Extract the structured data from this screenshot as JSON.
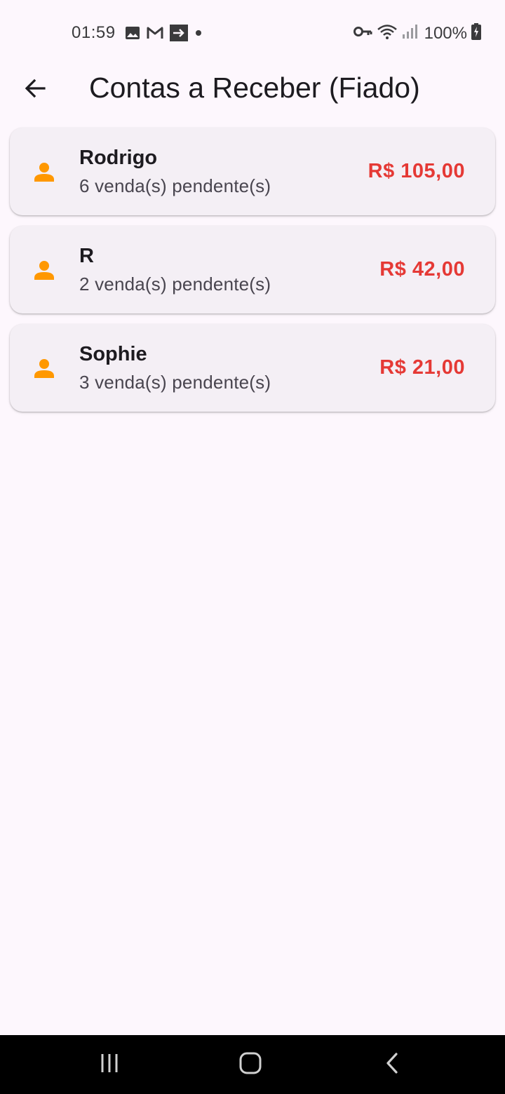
{
  "status_bar": {
    "time": "01:59",
    "battery": "100%",
    "left_icons": [
      "image-icon",
      "gmail-icon",
      "cast-icon",
      "dot-icon"
    ],
    "right_icons": [
      "vpn-key-icon",
      "wifi-icon",
      "signal-icon",
      "battery-charging-icon"
    ]
  },
  "app_bar": {
    "title": "Contas a Receber (Fiado)",
    "back_icon": "arrow-back-icon"
  },
  "colors": {
    "background": "#fdf7fd",
    "card": "#f4eff5",
    "person_icon": "#ff9800",
    "amount": "#e53935",
    "text": "#1d1b20",
    "subtext": "#49454f"
  },
  "customers": [
    {
      "name": "Rodrigo",
      "pending": "6 venda(s) pendente(s)",
      "amount": "R$ 105,00"
    },
    {
      "name": "R",
      "pending": "2 venda(s) pendente(s)",
      "amount": "R$ 42,00"
    },
    {
      "name": "Sophie",
      "pending": "3 venda(s) pendente(s)",
      "amount": "R$ 21,00"
    }
  ],
  "nav_bar": {
    "buttons": [
      "recent-apps-icon",
      "home-icon",
      "back-icon"
    ]
  }
}
